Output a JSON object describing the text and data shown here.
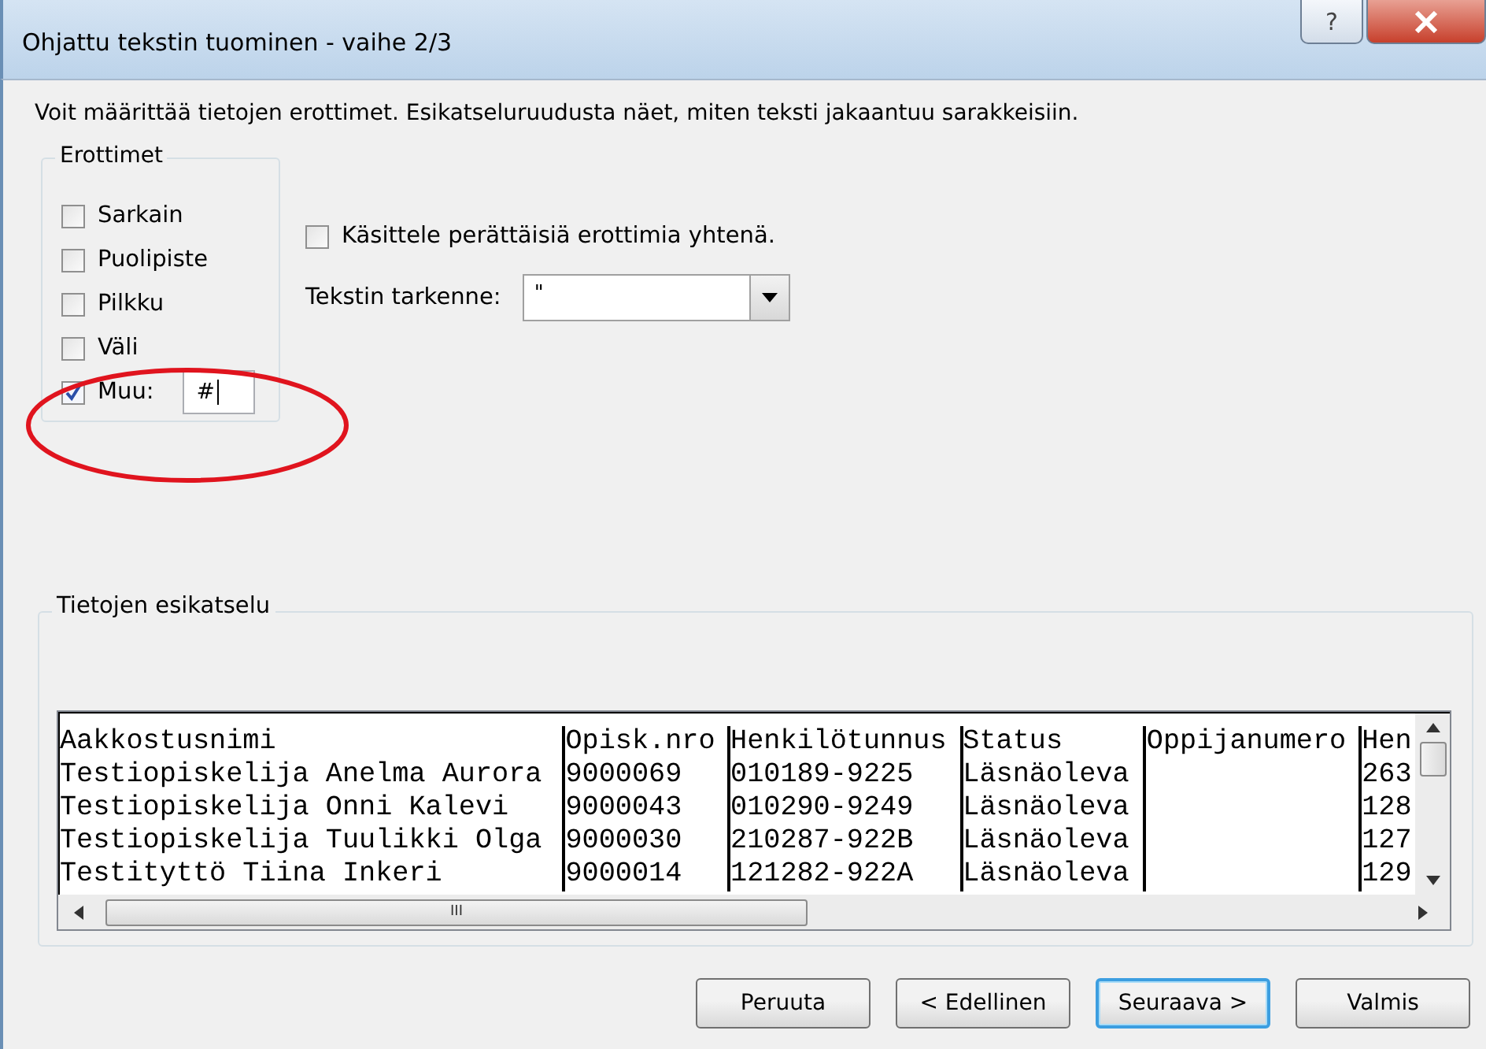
{
  "window": {
    "title": "Ohjattu tekstin tuominen - vaihe 2/3",
    "help": "?"
  },
  "instruction": "Voit määrittää tietojen erottimet. Esikatseluruudusta näet, miten teksti jakaantuu sarakkeisiin.",
  "delimiters": {
    "title": "Erottimet",
    "options": [
      {
        "label": "Sarkain",
        "checked": false
      },
      {
        "label": "Puolipiste",
        "checked": false
      },
      {
        "label": "Pilkku",
        "checked": false
      },
      {
        "label": "Väli",
        "checked": false
      },
      {
        "label": "Muu:",
        "checked": true,
        "value": "#"
      }
    ]
  },
  "consecutive": {
    "label": "Käsittele perättäisiä erottimia yhtenä.",
    "checked": false
  },
  "text_qualifier": {
    "label": "Tekstin tarkenne:",
    "value": "\""
  },
  "preview": {
    "title": "Tietojen esikatselu",
    "rows": [
      [
        "Aakkostusnimi",
        "Opisk.nro",
        "Henkilötunnus",
        "Status",
        "Oppijanumero",
        "Hen"
      ],
      [
        "Testiopiskelija Anelma Aurora",
        "9000069",
        "010189-9225",
        "Läsnäoleva",
        "",
        "263"
      ],
      [
        "Testiopiskelija Onni Kalevi",
        "9000043",
        "010290-9249",
        "Läsnäoleva",
        "",
        "128"
      ],
      [
        "Testiopiskelija Tuulikki Olga",
        "9000030",
        "210287-922B",
        "Läsnäoleva",
        "",
        "127"
      ],
      [
        "Testityttö Tiina Inkeri",
        "9000014",
        "121282-922A",
        "Läsnäoleva",
        "",
        "129"
      ]
    ],
    "scroll_thumb": "III"
  },
  "buttons": [
    {
      "label": "Peruuta",
      "default": false
    },
    {
      "label": "< Edellinen",
      "default": false
    },
    {
      "label": "Seuraava >",
      "default": true
    },
    {
      "label": "Valmis",
      "default": false
    }
  ]
}
